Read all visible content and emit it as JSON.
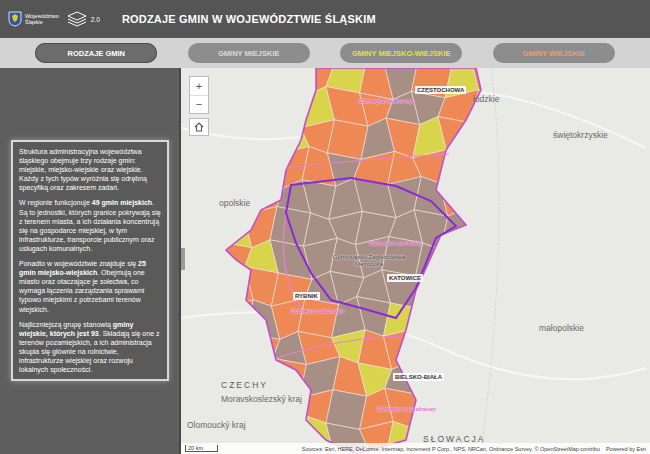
{
  "header": {
    "logo_lines": [
      "Województwo",
      "Śląskie"
    ],
    "version": "2.0",
    "title": "RODZAJE GMIN W WOJEWÓDZTWIE ŚLĄSKIM"
  },
  "tabs": [
    {
      "label": "RODZAJE GMIN",
      "selected": true,
      "color": "#ffffff"
    },
    {
      "label": "GMINY MIEJSKIE",
      "selected": false,
      "color": "#d9d9d9"
    },
    {
      "label": "GMINY MIEJSKO-WIEJSKIE",
      "selected": false,
      "color": "#e6df4a"
    },
    {
      "label": "GMINY WIEJSKIE",
      "selected": false,
      "color": "#f29a6a"
    }
  ],
  "sidebar": {
    "paragraphs": [
      [
        {
          "text": "Struktura administracyjna województwa śląskiego obejmuje trzy rodzaje gmin: miejskie, miejsko-wiejskie oraz wiejskie. Każdy z tych typów wyróżnia się odrębną specyfiką oraz zakresem zadań.",
          "bold": false
        }
      ],
      [
        {
          "text": "W regionie funkcjonuje ",
          "bold": false
        },
        {
          "text": "49 gmin miejskich",
          "bold": true
        },
        {
          "text": ". Są to jednostki, których granice pokrywają się z terenem miasta, a ich działania koncentrują się na gospodarce miejskiej, w tym infrastrukturze, transporcie publicznym oraz usługach komunalnych.",
          "bold": false
        }
      ],
      [
        {
          "text": "Ponadto w województwie znajduje się ",
          "bold": false
        },
        {
          "text": "25 gmin miejsko-wiejskich",
          "bold": true
        },
        {
          "text": ". Obejmują one miasto oraz otaczające je sołectwa, co wymaga łączenia zarządzania sprawami typowo miejskimi z potrzebami terenów wiejskich.",
          "bold": false
        }
      ],
      [
        {
          "text": "Najliczniejszą grupę stanowią ",
          "bold": false
        },
        {
          "text": "gminy wiejskie, których jest 93",
          "bold": true
        },
        {
          "text": ". Składają się one z terenów pozamiejskich, a ich administracja skupia się głównie na rolnictwie, infrastrukturze wiejskiej oraz rozwoju lokalnych społeczności.",
          "bold": false
        }
      ]
    ]
  },
  "map": {
    "zoom_in": "+",
    "zoom_out": "−",
    "labels": [
      {
        "text": "łódzkie",
        "kind": "region"
      },
      {
        "text": "świętokrzyskie",
        "kind": "region"
      },
      {
        "text": "opolskie",
        "kind": "region"
      },
      {
        "text": "małopolskie",
        "kind": "region"
      },
      {
        "text": "CZECHY",
        "kind": "country"
      },
      {
        "text": "Moravskoslezský kraj",
        "kind": "region"
      },
      {
        "text": "Olomoucký kraj",
        "kind": "region"
      },
      {
        "text": "SŁOWACJA",
        "kind": "country"
      },
      {
        "text": "Subregion północny",
        "kind": "subregion"
      },
      {
        "text": "CZĘSTOCHOWA",
        "kind": "city"
      },
      {
        "text": "Subregion centralny",
        "kind": "subregion"
      },
      {
        "text": "Górnośląsko-Zagłębiowska Metropolia",
        "kind": "metro"
      },
      {
        "text": "KATOWICE",
        "kind": "city"
      },
      {
        "text": "RYBNIK",
        "kind": "city"
      },
      {
        "text": "Subregion zachodni",
        "kind": "subregion"
      },
      {
        "text": "BIELSKO-BIAŁA",
        "kind": "city"
      },
      {
        "text": "Subregion południowy",
        "kind": "subregion"
      }
    ],
    "municipalities": [
      [
        "w",
        "w",
        "w",
        "w",
        "m",
        "w",
        "u",
        "w",
        "m",
        "w"
      ],
      [
        "w",
        "w",
        "w",
        "m",
        "w",
        "w",
        "u",
        "u",
        "w",
        "w"
      ],
      [
        "w",
        "w",
        "m",
        "w",
        "w",
        "u",
        "w",
        "m",
        "w",
        "w"
      ],
      [
        "w",
        "m",
        "w",
        "w",
        "u",
        "w",
        "w",
        "w",
        "m",
        "w"
      ],
      [
        "w",
        "w",
        "u",
        "u",
        "u",
        "u",
        "u",
        "u",
        "w",
        "w"
      ],
      [
        "m",
        "w",
        "u",
        "u",
        "u",
        "u",
        "u",
        "u",
        "u",
        "w"
      ],
      [
        "w",
        "m",
        "u",
        "u",
        "u",
        "u",
        "u",
        "u",
        "w",
        "w"
      ],
      [
        "w",
        "w",
        "w",
        "u",
        "u",
        "u",
        "u",
        "u",
        "w",
        "w"
      ],
      [
        "w",
        "u",
        "w",
        "w",
        "u",
        "u",
        "m",
        "w",
        "w",
        "w"
      ],
      [
        "w",
        "w",
        "u",
        "w",
        "m",
        "w",
        "w",
        "m",
        "w",
        "w"
      ],
      [
        "w",
        "m",
        "w",
        "u",
        "w",
        "m",
        "u",
        "w",
        "w",
        "w"
      ],
      [
        "w",
        "w",
        "m",
        "w",
        "u",
        "w",
        "w",
        "m",
        "w",
        "w"
      ],
      [
        "w",
        "w",
        "w",
        "m",
        "u",
        "w",
        "m",
        "w",
        "w",
        "w"
      ]
    ],
    "scale": "20 km",
    "attribution": "Sources: Esri, HERE, DeLorme, Intermap, increment P Corp., NPS, NRCan, Ordnance Survey, © OpenStreetMap contribu",
    "powered_by": "Powered by Esri"
  }
}
